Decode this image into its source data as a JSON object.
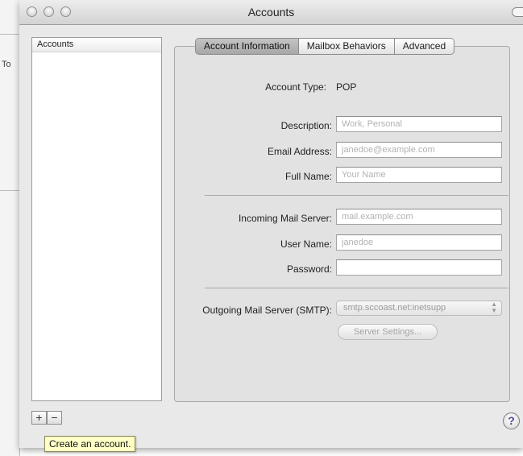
{
  "background_window": {
    "fragment": "To"
  },
  "window": {
    "title": "Accounts"
  },
  "sidebar": {
    "header": "Accounts"
  },
  "tabs": [
    {
      "label": "Account Information",
      "active": true
    },
    {
      "label": "Mailbox Behaviors",
      "active": false
    },
    {
      "label": "Advanced",
      "active": false
    }
  ],
  "form": {
    "account_type_label": "Account Type:",
    "account_type_value": "POP",
    "description": {
      "label": "Description:",
      "placeholder": "Work, Personal"
    },
    "email": {
      "label": "Email Address:",
      "placeholder": "janedoe@example.com"
    },
    "full_name": {
      "label": "Full Name:",
      "placeholder": "Your Name"
    },
    "incoming_server": {
      "label": "Incoming Mail Server:",
      "placeholder": "mail.example.com"
    },
    "user_name": {
      "label": "User Name:",
      "placeholder": "janedoe"
    },
    "password": {
      "label": "Password:",
      "value": ""
    },
    "smtp": {
      "label": "Outgoing Mail Server (SMTP):",
      "value": "smtp.sccoast.net:inetsupp"
    },
    "server_settings_button": "Server Settings..."
  },
  "bottom": {
    "add_label": "+",
    "remove_label": "−",
    "help_label": "?"
  },
  "tooltip": "Create an account."
}
